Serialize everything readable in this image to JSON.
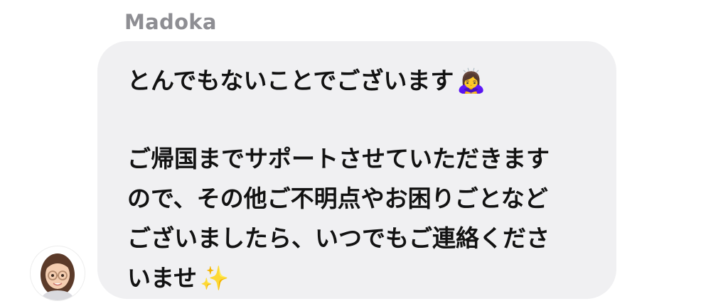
{
  "message": {
    "sender": "Madoka",
    "lines": [
      {
        "text": "とんでもないことでございます",
        "emoji": "🙇‍♀️"
      },
      {
        "text": "",
        "emoji": ""
      },
      {
        "text": "ご帰国までサポートさせていただきます",
        "emoji": ""
      },
      {
        "text": "ので、その他ご不明点やお困りごとなど",
        "emoji": ""
      },
      {
        "text": "ございましたら、いつでもご連絡くださ",
        "emoji": ""
      },
      {
        "text": "いませ",
        "emoji": "✨"
      }
    ],
    "avatar_icon": "memoji-avatar-icon"
  },
  "colors": {
    "bubble_bg": "#f0f0f2",
    "sender_name": "#8e8e93",
    "text": "#121212"
  }
}
